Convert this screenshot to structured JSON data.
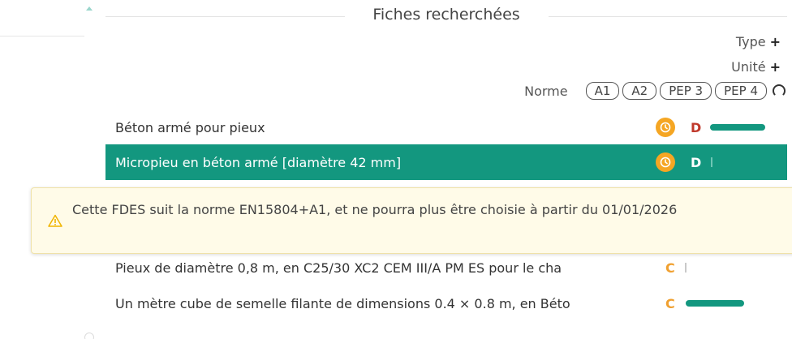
{
  "panel": {
    "title": "Fiches recherchées"
  },
  "filters": {
    "type_label": "Type",
    "unite_label": "Unité",
    "plus": "+",
    "norme_label": "Norme",
    "norme_options": [
      "A1",
      "A2",
      "PEP 3",
      "PEP 4"
    ]
  },
  "results": [
    {
      "name": "Béton armé pour pieux",
      "grade": "D",
      "has_clock": true,
      "impact_fraction": 0.95,
      "selected": false
    },
    {
      "name": "Micropieu en béton armé [diamètre 42 mm]",
      "grade": "D",
      "has_clock": true,
      "impact_fraction": 0.0,
      "selected": true
    },
    {
      "name": "Pieux de diamètre 0,8 m, en C25/30 XC2 CEM III/A PM ES pour le cha",
      "grade": "C",
      "has_clock": false,
      "impact_fraction": 0.0,
      "selected": false
    },
    {
      "name": "Un mètre cube de semelle filante de dimensions 0.4 × 0.8 m, en Béto",
      "grade": "C",
      "has_clock": false,
      "impact_fraction": 1.0,
      "selected": false
    }
  ],
  "warning": {
    "message": "Cette FDES suit la norme EN15804+A1, et ne pourra plus être choisie à partir du 01/01/2026",
    "icon": "warning-triangle-icon",
    "color": "#f0b400"
  },
  "colors": {
    "accent": "#13977f",
    "clock": "#f5a623",
    "grade_d": "#c0392b",
    "grade_c": "#f0a030"
  }
}
